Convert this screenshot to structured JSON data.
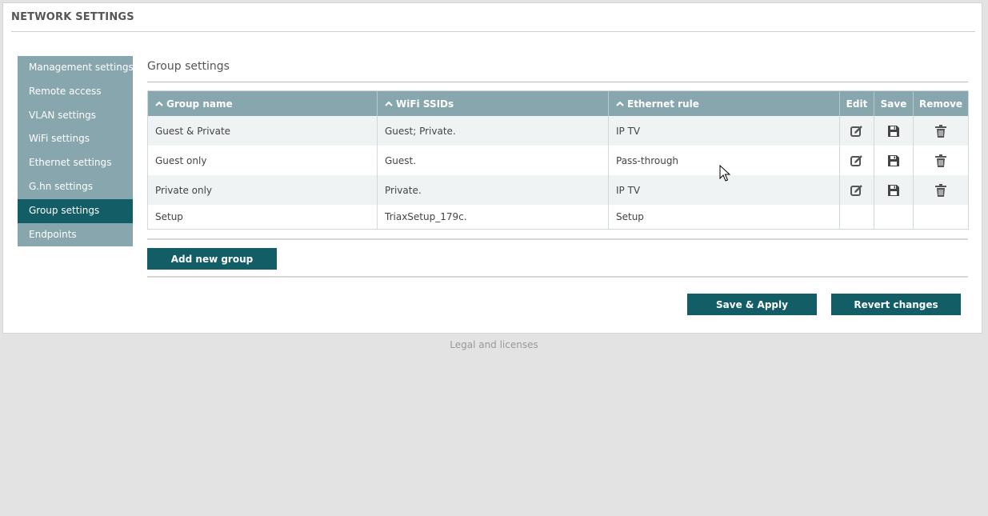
{
  "header": {
    "title": "NETWORK SETTINGS"
  },
  "sidebar": {
    "items": [
      {
        "label": "Management settings",
        "active": false
      },
      {
        "label": "Remote access",
        "active": false
      },
      {
        "label": "VLAN settings",
        "active": false
      },
      {
        "label": "WiFi settings",
        "active": false
      },
      {
        "label": "Ethernet settings",
        "active": false
      },
      {
        "label": "G.hn settings",
        "active": false
      },
      {
        "label": "Group settings",
        "active": true
      },
      {
        "label": "Endpoints",
        "active": false
      }
    ]
  },
  "main": {
    "section_title": "Group settings",
    "table": {
      "columns": {
        "group_name": "Group name",
        "wifi_ssids": "WiFi SSIDs",
        "ethernet_rule": "Ethernet rule",
        "edit": "Edit",
        "save": "Save",
        "remove": "Remove"
      },
      "rows": [
        {
          "group_name": "Guest & Private",
          "wifi_ssids": "Guest; Private.",
          "ethernet_rule": "IP TV",
          "actions": true
        },
        {
          "group_name": "Guest only",
          "wifi_ssids": "Guest.",
          "ethernet_rule": "Pass-through",
          "actions": true
        },
        {
          "group_name": "Private only",
          "wifi_ssids": "Private.",
          "ethernet_rule": "IP TV",
          "actions": true
        },
        {
          "group_name": "Setup",
          "wifi_ssids": "TriaxSetup_179c.",
          "ethernet_rule": "Setup",
          "actions": false
        }
      ]
    },
    "add_group_label": "Add new group",
    "save_apply_label": "Save & Apply",
    "revert_label": "Revert changes"
  },
  "footer": {
    "legal_label": "Legal and licenses"
  },
  "icons": {
    "sort": "chevron-up-icon",
    "edit": "edit-icon",
    "save": "floppy-disk-icon",
    "remove": "trash-icon"
  },
  "colors": {
    "accent": "#135e66",
    "sidebar": "#88a6ad",
    "background": "#e3e3e3"
  }
}
